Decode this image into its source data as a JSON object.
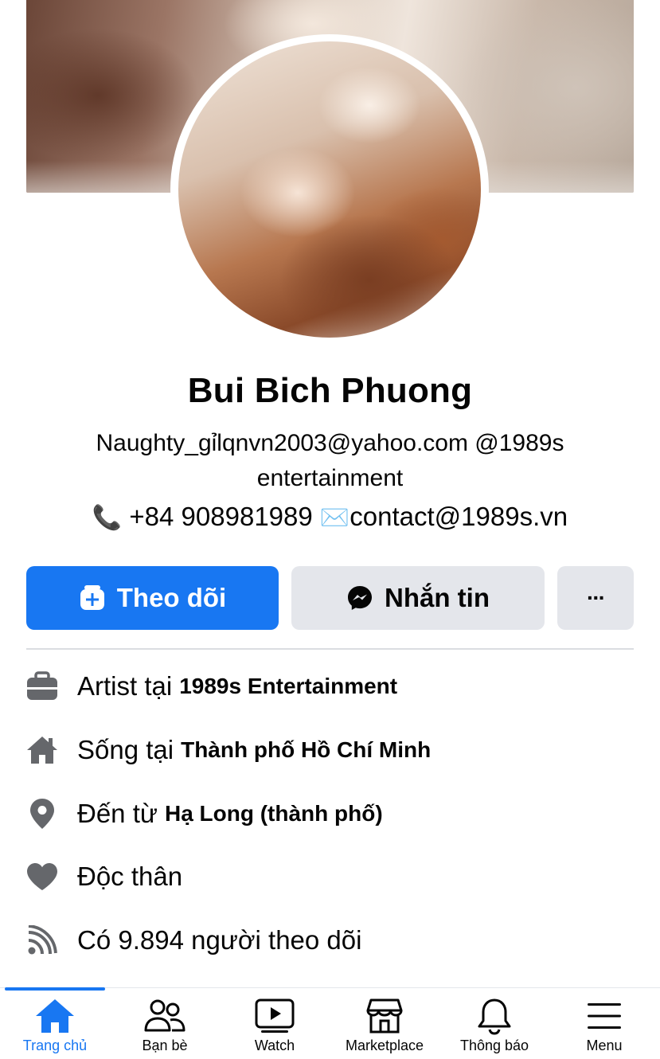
{
  "profile": {
    "name": "Bui Bich Phuong",
    "bio": "Naughty_gỉlqnvn2003@yahoo.com @1989s entertainment",
    "phone_icon": "📞",
    "phone": "+84 908981989",
    "mail_icon": "✉️",
    "email": "contact@1989s.vn"
  },
  "actions": {
    "follow_label": "Theo dõi",
    "message_label": "Nhắn tin",
    "more_label": "···"
  },
  "info": {
    "work_prefix": "Artist tại",
    "work_place": "1989s Entertainment",
    "lives_prefix": "Sống tại",
    "lives_place": "Thành phố Hồ Chí Minh",
    "from_prefix": "Đến từ",
    "from_place": "Hạ Long (thành phố)",
    "relationship": "Độc thân",
    "followers": "Có 9.894 người theo dõi"
  },
  "tabs": [
    {
      "label": "Trang chủ",
      "icon": "home-icon",
      "active": true
    },
    {
      "label": "Bạn bè",
      "icon": "friends-icon",
      "active": false
    },
    {
      "label": "Watch",
      "icon": "watch-icon",
      "active": false
    },
    {
      "label": "Marketplace",
      "icon": "marketplace-icon",
      "active": false
    },
    {
      "label": "Thông báo",
      "icon": "bell-icon",
      "active": false
    },
    {
      "label": "Menu",
      "icon": "menu-icon",
      "active": false
    }
  ],
  "colors": {
    "accent": "#1877f2",
    "button_gray": "#e4e6eb",
    "icon_gray": "#65676b"
  }
}
